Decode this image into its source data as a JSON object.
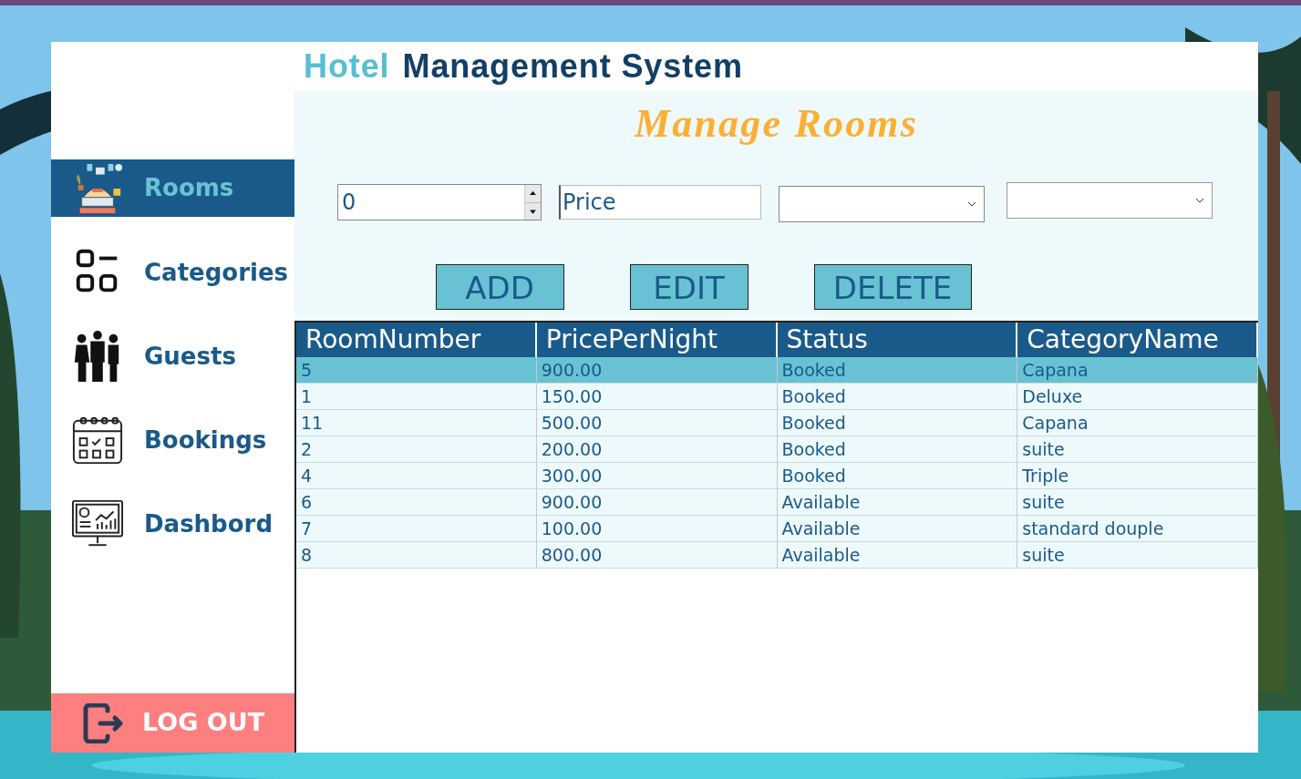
{
  "header": {
    "title_parts": [
      {
        "text": "Hotel",
        "kind": "accent"
      },
      {
        "text": "Management System",
        "kind": "main"
      }
    ]
  },
  "sidebar": {
    "items": [
      {
        "label": "Rooms",
        "kind": "rooms",
        "selected": true
      },
      {
        "label": "Categories",
        "kind": "categories",
        "selected": false
      },
      {
        "label": "Guests",
        "kind": "guests",
        "selected": false
      },
      {
        "label": "Bookings",
        "kind": "bookings",
        "selected": false
      },
      {
        "label": "Dashbord",
        "kind": "dashboard",
        "selected": false
      }
    ],
    "logout": "LOG OUT"
  },
  "page_title": "Manage Rooms",
  "form": {
    "room_number": "0",
    "price": "Price",
    "dropdowns": [
      {
        "kind": "status"
      },
      {
        "kind": "category"
      }
    ]
  },
  "buttons": [
    "ADD",
    "EDIT",
    "DELETE"
  ],
  "table": {
    "columns": [
      "RoomNumber",
      "PricePerNight",
      "Status",
      "CategoryName"
    ],
    "rows": [
      {
        "cells": [
          "5",
          "900.00",
          "Booked",
          "Capana"
        ],
        "selected": true
      },
      {
        "cells": [
          "1",
          "150.00",
          "Booked",
          "Deluxe"
        ],
        "selected": false
      },
      {
        "cells": [
          "11",
          "500.00",
          "Booked",
          "Capana"
        ],
        "selected": false
      },
      {
        "cells": [
          "2",
          "200.00",
          "Booked",
          "suite"
        ],
        "selected": false
      },
      {
        "cells": [
          "4",
          "300.00",
          "Booked",
          "Triple"
        ],
        "selected": false
      },
      {
        "cells": [
          "6",
          "900.00",
          "Available",
          "suite"
        ],
        "selected": false
      },
      {
        "cells": [
          "7",
          "100.00",
          "Available",
          "standard douple"
        ],
        "selected": false
      },
      {
        "cells": [
          "8",
          "800.00",
          "Available",
          "suite"
        ],
        "selected": false
      }
    ]
  }
}
